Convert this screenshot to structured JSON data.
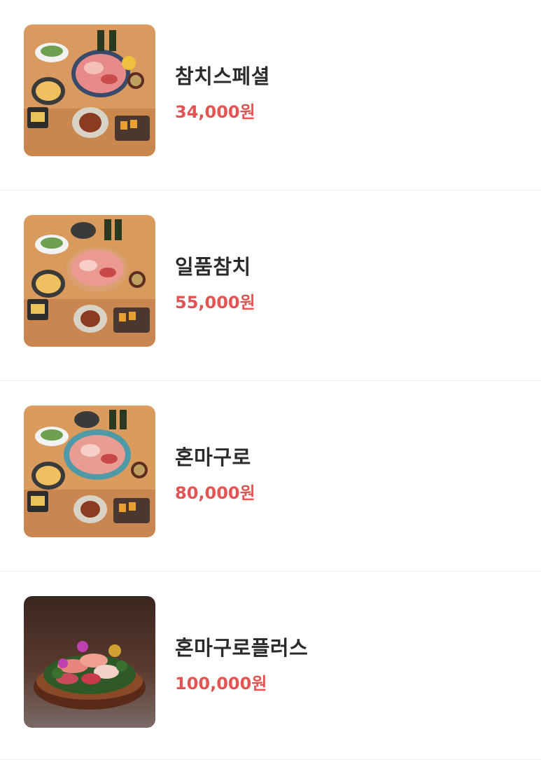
{
  "menu": {
    "items": [
      {
        "name": "참치스페셜",
        "price": "34,000원",
        "image_icon": "tuna-special-set-photo"
      },
      {
        "name": "일품참치",
        "price": "55,000원",
        "image_icon": "premium-tuna-set-photo"
      },
      {
        "name": "혼마구로",
        "price": "80,000원",
        "image_icon": "bluefin-tuna-set-photo"
      },
      {
        "name": "혼마구로플러스",
        "price": "100,000원",
        "image_icon": "bluefin-tuna-plus-platter-photo"
      }
    ]
  },
  "colors": {
    "price": "#e25353",
    "name": "#2b2b2b",
    "divider": "#ececec"
  }
}
